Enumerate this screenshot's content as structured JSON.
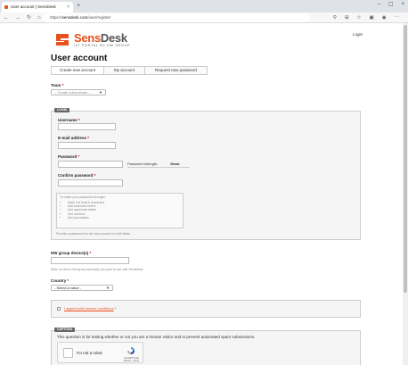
{
  "browser": {
    "tab_title": "User account | SensDesk",
    "tab_close": "×",
    "new_tab": "+",
    "url_prefix": "https://",
    "url_host": "sensdesk.com",
    "url_path": "/user/register",
    "minimize": "–",
    "maximize": "☐",
    "close": "×"
  },
  "header": {
    "brand_main": "Sens",
    "brand_second": "Desk",
    "tagline": "IoT PORTAL BY HW GROUP",
    "login_link": "Login"
  },
  "page": {
    "title": "User account",
    "tabs": [
      {
        "label": "Create new account"
      },
      {
        "label": "My account"
      },
      {
        "label": "Request new password"
      }
    ]
  },
  "form": {
    "team_label": "Team",
    "team_value": "– Create subordinate –",
    "login_legend": "LOGIN",
    "username_label": "Username",
    "email_label": "E-mail address",
    "password_label": "Password",
    "password_strength_label": "Password strength:",
    "password_strength_value": "Weak",
    "confirm_label": "Confirm password",
    "hint_title": "To make your password stronger:",
    "hints": [
      "Make it at least 6 characters",
      "Add lowercase letters",
      "Add uppercase letters",
      "Add numbers",
      "Add punctuation"
    ],
    "password_help": "Provide a password for the new account in both fields.",
    "device_label": "HW group device(s)",
    "device_help": "Write us which HW group device(s) you plan to use with SensDesk.",
    "country_label": "Country",
    "country_value": "- Select a value -",
    "license_text": "I agreed with license conditions",
    "captcha_legend": "CAPTCHA",
    "captcha_question": "This question is for testing whether or not you are a human visitor and to prevent automated spam submissions.",
    "recaptcha_label": "I'm not a robot",
    "recaptcha_brand": "reCAPTCHA",
    "recaptcha_links": "Privacy - Terms",
    "required_mark": "*"
  },
  "colors": {
    "brand": "#e8511c",
    "required": "#cc0000"
  }
}
